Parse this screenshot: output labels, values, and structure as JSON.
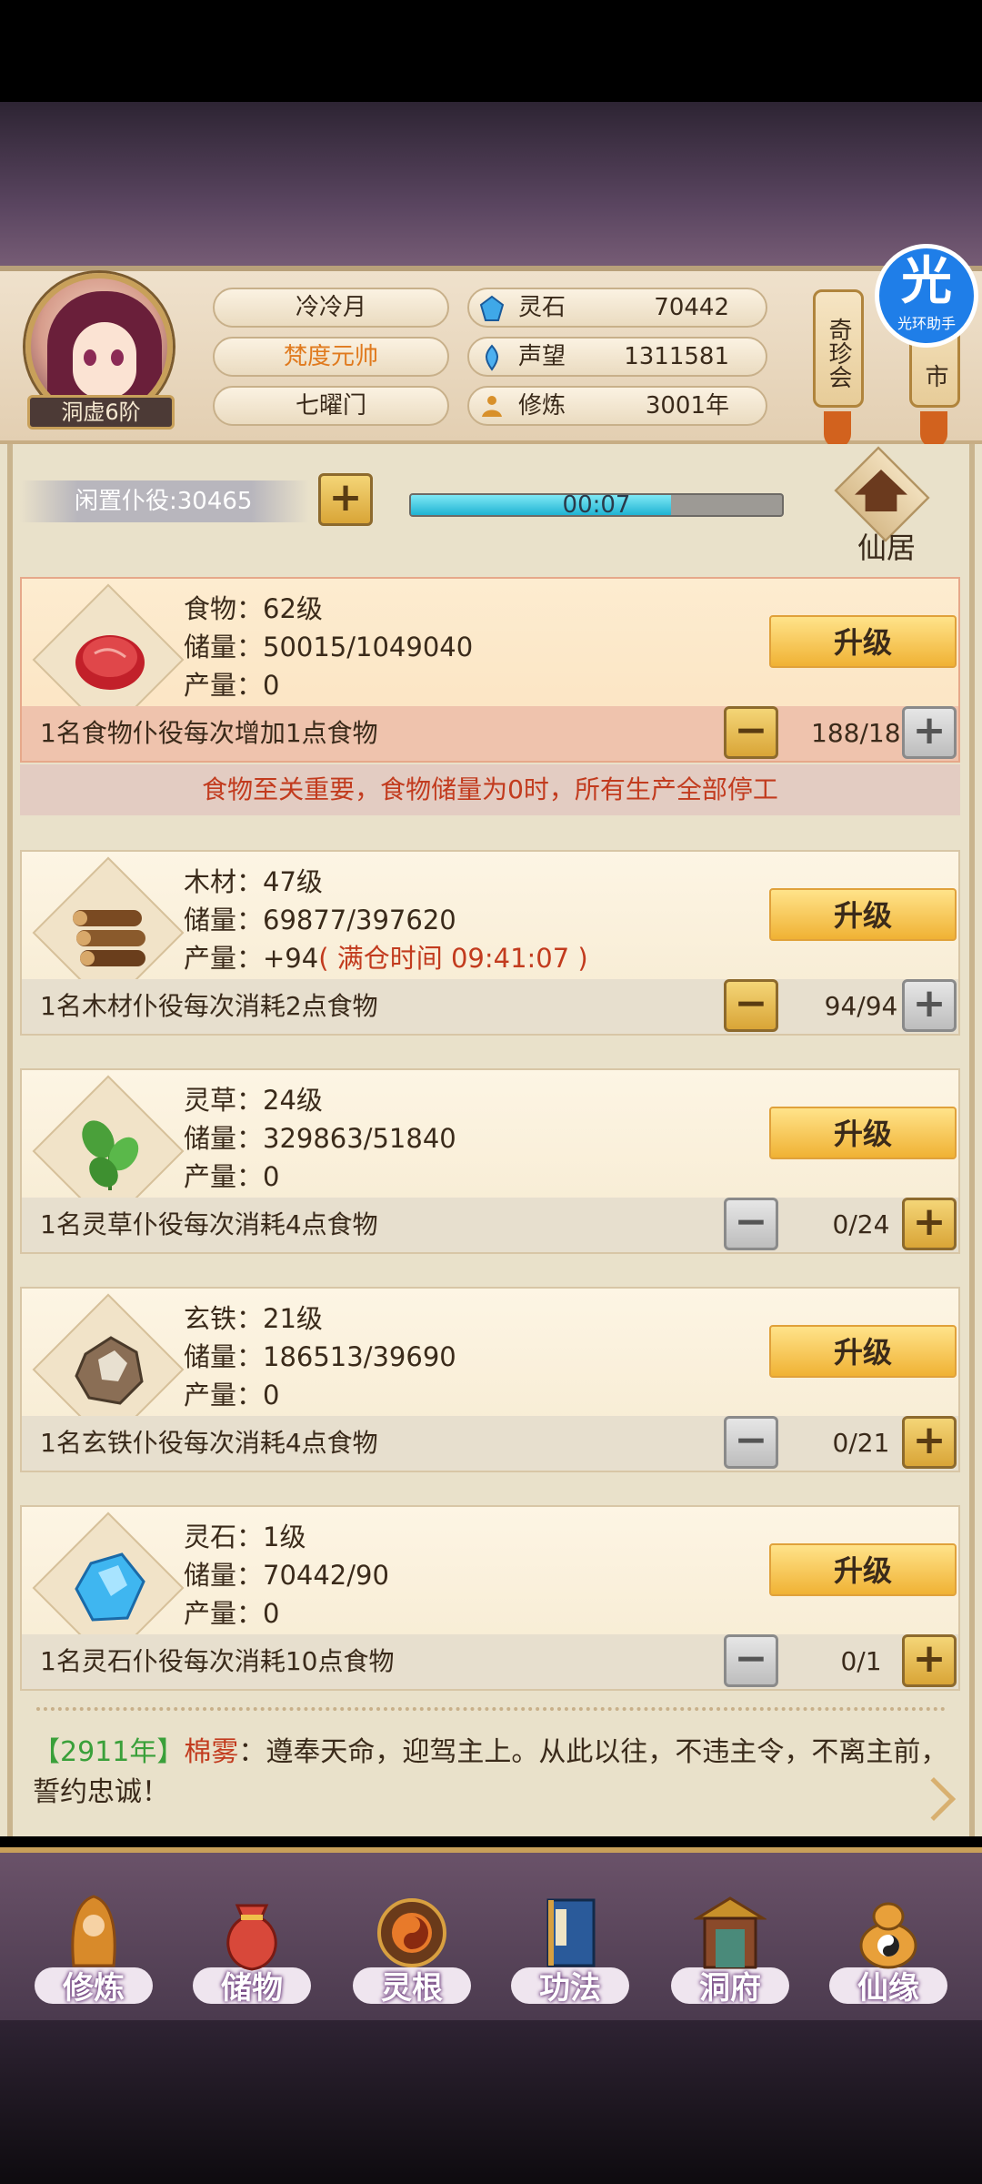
{
  "player": {
    "rank": "洞虚6阶",
    "name": "冷冷月",
    "title": "梵度元帅",
    "sect": "七曜门"
  },
  "stats": [
    {
      "label": "灵石",
      "value": "70442",
      "icon": "spirit-stone-icon"
    },
    {
      "label": "声望",
      "value": "1311581",
      "icon": "reputation-icon"
    },
    {
      "label": "修炼",
      "value": "3001年",
      "icon": "meditation-icon"
    }
  ],
  "side_buttons": {
    "qizhenhui": "奇珍会",
    "market": "市"
  },
  "overlay_badge": {
    "glyph": "光",
    "label": "光环助手"
  },
  "idle": {
    "label": "闲置仆役:30465",
    "timer": "00:07",
    "progress": 0.7
  },
  "xianju": {
    "label": "仙居"
  },
  "upgrade_label": "升级",
  "resources": [
    {
      "name": "食物",
      "level": "食物：62级",
      "storage": "储量：50015/1049040",
      "output": "产量：0",
      "output_extra": "",
      "desc": "1名食物仆役每次增加1点食物",
      "count": "188/188",
      "minus_active": true,
      "plus_active": false
    },
    {
      "name": "木材",
      "level": "木材：47级",
      "storage": "储量：69877/397620",
      "output": "产量：+94",
      "output_extra": "( 满仓时间 09:41:07 )",
      "desc": "1名木材仆役每次消耗2点食物",
      "count": "94/94",
      "minus_active": true,
      "plus_active": false
    },
    {
      "name": "灵草",
      "level": "灵草：24级",
      "storage": "储量：329863/51840",
      "output": "产量：0",
      "output_extra": "",
      "desc": "1名灵草仆役每次消耗4点食物",
      "count": "0/24",
      "minus_active": false,
      "plus_active": true
    },
    {
      "name": "玄铁",
      "level": "玄铁：21级",
      "storage": "储量：186513/39690",
      "output": "产量：0",
      "output_extra": "",
      "desc": "1名玄铁仆役每次消耗4点食物",
      "count": "0/21",
      "minus_active": false,
      "plus_active": true
    },
    {
      "name": "灵石",
      "level": "灵石：1级",
      "storage": "储量：70442/90",
      "output": "产量：0",
      "output_extra": "",
      "desc": "1名灵石仆役每次消耗10点食物",
      "count": "0/1",
      "minus_active": false,
      "plus_active": true
    }
  ],
  "notice": "食物至关重要，食物储量为0时，所有生产全部停工",
  "chat": {
    "year": "【2911年】",
    "speaker": "棉雾",
    "message": "：遵奉天命，迎驾主上。从此以往，不违主令，不离主前，誓约忠诚！"
  },
  "nav": [
    {
      "label": "修炼",
      "icon": "cultivate-icon"
    },
    {
      "label": "储物",
      "icon": "storage-bag-icon"
    },
    {
      "label": "灵根",
      "icon": "spirit-root-icon"
    },
    {
      "label": "功法",
      "icon": "skill-book-icon"
    },
    {
      "label": "洞府",
      "icon": "cave-house-icon"
    },
    {
      "label": "仙缘",
      "icon": "immortal-fate-icon"
    }
  ],
  "colors": {
    "accent_gold": "#f0b234",
    "warn_red": "#c23b1e",
    "progress_cyan": "#1fb3d3"
  }
}
